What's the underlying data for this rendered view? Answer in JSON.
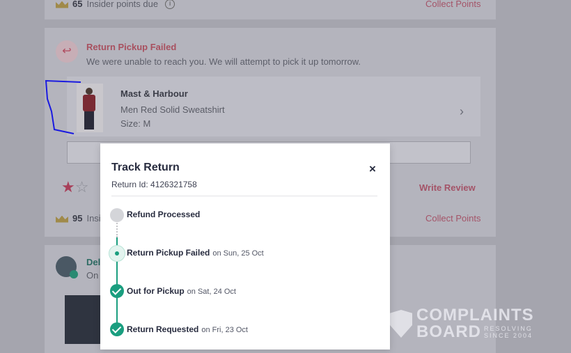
{
  "top_card": {
    "points": "65",
    "points_suffix": "Insider points due",
    "collect_label": "Collect Points"
  },
  "return_card": {
    "status_title": "Return Pickup Failed",
    "status_desc": "We were unable to reach you. We will attempt to pick it up tomorrow.",
    "product": {
      "brand": "Mast & Harbour",
      "name": "Men Red Solid Sweatshirt",
      "size": "Size: M"
    },
    "rating": 1,
    "write_review_label": "Write Review",
    "points": "95",
    "points_suffix": "Insi",
    "collect_label": "Collect Points"
  },
  "delivered_card": {
    "title": "Del",
    "subtitle": "On"
  },
  "modal": {
    "title": "Track Return",
    "return_id": "Return Id: 4126321758",
    "close_glyph": "×",
    "steps": [
      {
        "label": "Refund Processed",
        "date": "",
        "state": "pending"
      },
      {
        "label": "Return Pickup Failed",
        "date": "on Sun, 25 Oct",
        "state": "current"
      },
      {
        "label": "Out for Pickup",
        "date": "on Sat, 24 Oct",
        "state": "done"
      },
      {
        "label": "Return Requested",
        "date": "on Fri, 23 Oct",
        "state": "done"
      }
    ]
  },
  "watermark": {
    "line1": "COMPLAINTS",
    "line2": "BOARD",
    "tag1": "RESOLVING",
    "tag2": "SINCE 2004"
  },
  "colors": {
    "accent_green": "#1a9e7f",
    "accent_pink": "#a45468",
    "annotation_blue": "#1a1ae0"
  }
}
